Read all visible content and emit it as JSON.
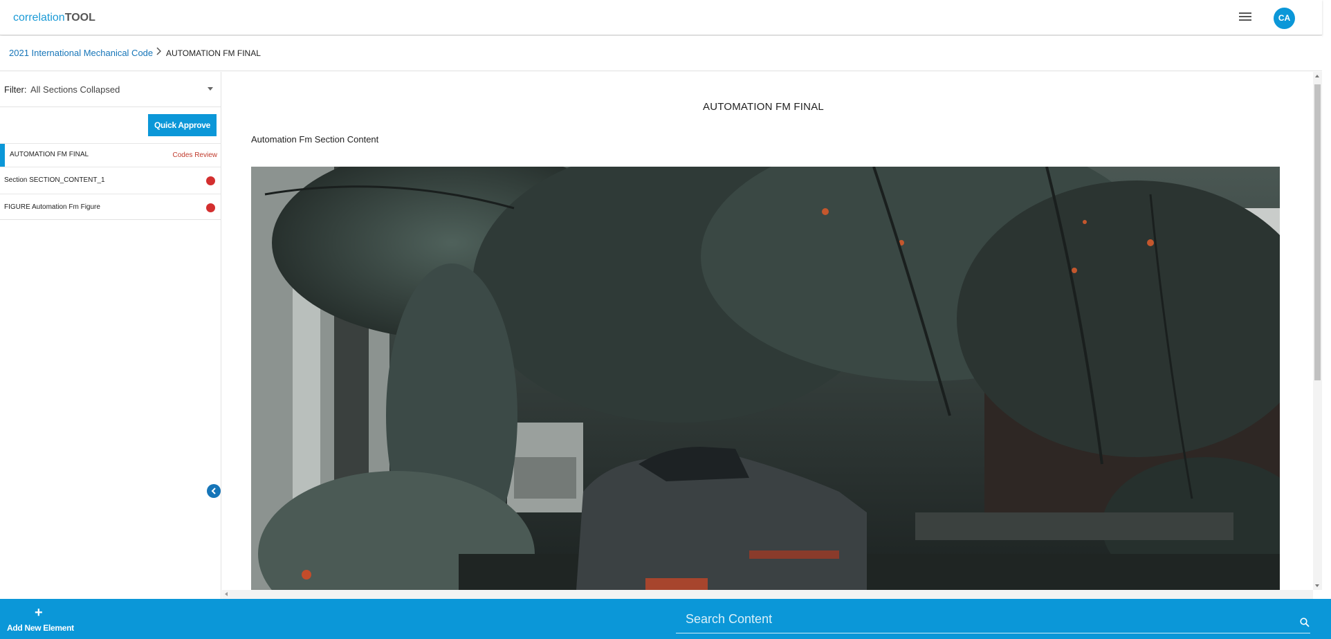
{
  "app": {
    "brand_light": "correlation",
    "brand_bold": "TOOL",
    "user_initials": "CA"
  },
  "breadcrumb": {
    "parent": "2021 International Mechanical Code",
    "current": "AUTOMATION FM FINAL"
  },
  "filter": {
    "label": "Filter:",
    "value": "All Sections Collapsed"
  },
  "sidebar": {
    "quick_approve_label": "Quick Approve",
    "items": [
      {
        "title": "AUTOMATION FM FINAL",
        "status": "Codes Review"
      },
      {
        "label": "Section SECTION_CONTENT_1",
        "status_color": "#d32f2f"
      },
      {
        "label": "FIGURE Automation Fm Figure",
        "status_color": "#d32f2f"
      }
    ]
  },
  "main": {
    "title": "AUTOMATION FM FINAL",
    "section_content": "Automation Fm Section Content"
  },
  "bottom": {
    "add_label": "Add New Element",
    "search_placeholder": "Search Content"
  },
  "colors": {
    "accent": "#0b97d8",
    "link": "#1675b8",
    "status_red": "#d32f2f",
    "codes_review": "#c0392b"
  }
}
